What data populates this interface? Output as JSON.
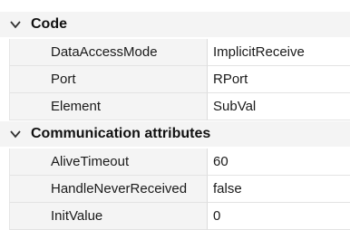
{
  "sections": [
    {
      "title": "Code",
      "rows": [
        {
          "name": "DataAccessMode",
          "value": "ImplicitReceive"
        },
        {
          "name": "Port",
          "value": "RPort"
        },
        {
          "name": "Element",
          "value": "SubVal"
        }
      ]
    },
    {
      "title": "Communication attributes",
      "rows": [
        {
          "name": "AliveTimeout",
          "value": "60"
        },
        {
          "name": "HandleNeverReceived",
          "value": "false"
        },
        {
          "name": "InitValue",
          "value": "0"
        }
      ]
    }
  ],
  "icons": {
    "expand": "chevron-down-icon"
  }
}
